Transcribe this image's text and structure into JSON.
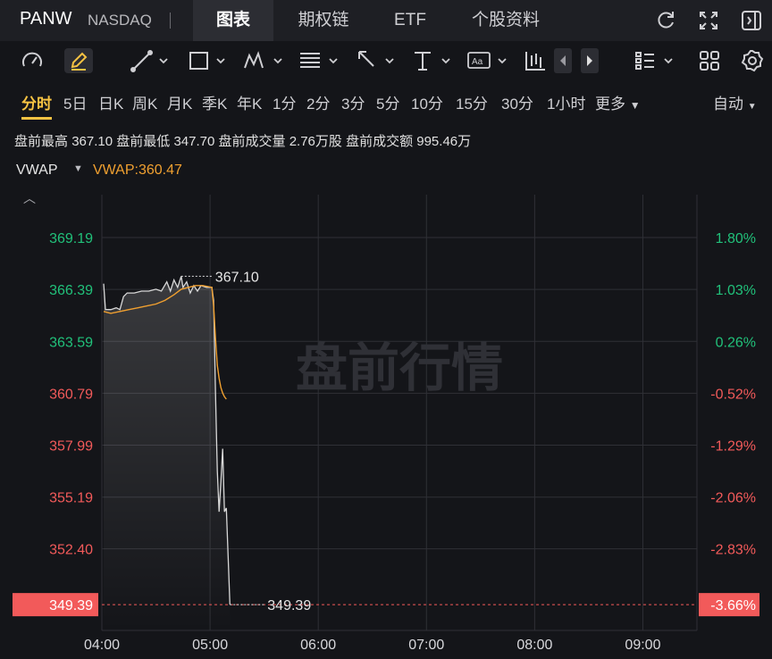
{
  "header": {
    "symbol": "PANW",
    "exchange": "NASDAQ",
    "tabs": [
      {
        "label": "图表",
        "active": true
      },
      {
        "label": "期权链",
        "active": false
      },
      {
        "label": "ETF",
        "active": false
      },
      {
        "label": "个股资料",
        "active": false
      }
    ],
    "icons": [
      "refresh-icon",
      "fullscreen-icon",
      "collapse-panel-icon"
    ]
  },
  "toolbar": {
    "icons": [
      "speedometer-icon",
      "pencil-icon",
      "line-tool-icon",
      "rectangle-tool-icon",
      "pattern-tool-icon",
      "fib-tool-icon",
      "arrow-tool-icon",
      "price-level-icon",
      "text-tool-icon",
      "candlestick-icon",
      "chevron-left-icon",
      "chevron-right-icon",
      "layout-list-icon",
      "grid-icon",
      "settings-icon"
    ]
  },
  "periods": {
    "items": [
      "分时",
      "5日",
      "日K",
      "周K",
      "月K",
      "季K",
      "年K",
      "1分",
      "2分",
      "3分",
      "5分",
      "10分",
      "15分",
      "30分",
      "1小时",
      "更多"
    ],
    "active": "分时",
    "adjust": "自动"
  },
  "info": {
    "premarket_high_label": "盘前最高",
    "premarket_high": "367.10",
    "premarket_low_label": "盘前最低",
    "premarket_low": "347.70",
    "premarket_volume_label": "盘前成交量",
    "premarket_volume": "2.76万股",
    "premarket_turnover_label": "盘前成交额",
    "premarket_turnover": "995.46万"
  },
  "indicator": {
    "name": "VWAP",
    "value_label": "VWAP:360.47"
  },
  "colors": {
    "background": "#141519",
    "grid": "#2f3036",
    "price_line": "#d8d8d8",
    "vwap_line": "#f0a030",
    "up": "#21c17a",
    "down": "#f25a5a",
    "current_badge": "#f25a5a",
    "active_period": "#f6c343"
  },
  "chart_data": {
    "type": "line",
    "watermark": "盘前行情",
    "x_ticks": [
      "04:00",
      "05:00",
      "06:00",
      "07:00",
      "08:00",
      "09:00"
    ],
    "xlim": [
      "04:00",
      "09:30"
    ],
    "y_ticks_left": [
      {
        "value": 369.19,
        "label": "369.19",
        "side": "up"
      },
      {
        "value": 366.39,
        "label": "366.39",
        "side": "up"
      },
      {
        "value": 363.59,
        "label": "363.59",
        "side": "up"
      },
      {
        "value": 360.79,
        "label": "360.79",
        "side": "down"
      },
      {
        "value": 357.99,
        "label": "357.99",
        "side": "down"
      },
      {
        "value": 355.19,
        "label": "355.19",
        "side": "down"
      },
      {
        "value": 352.4,
        "label": "352.40",
        "side": "down"
      }
    ],
    "y_ticks_right": [
      {
        "value": 369.19,
        "label": "1.80%",
        "side": "up"
      },
      {
        "value": 366.39,
        "label": "1.03%",
        "side": "up"
      },
      {
        "value": 363.59,
        "label": "0.26%",
        "side": "up"
      },
      {
        "value": 360.79,
        "label": "-0.52%",
        "side": "down"
      },
      {
        "value": 357.99,
        "label": "-1.29%",
        "side": "down"
      },
      {
        "value": 355.19,
        "label": "-2.06%",
        "side": "down"
      },
      {
        "value": 352.4,
        "label": "-2.83%",
        "side": "down"
      }
    ],
    "ylim": [
      348.0,
      371.5
    ],
    "current_price": {
      "value": 349.39,
      "label": "349.39",
      "pct_label": "-3.66%"
    },
    "high_marker": {
      "time": "04:44",
      "value": 367.1,
      "label": "367.10"
    },
    "low_marker": {
      "time": "05:11",
      "value": 349.39,
      "label": "349.39"
    },
    "series": [
      {
        "name": "price",
        "points": [
          [
            "04:01",
            366.7
          ],
          [
            "04:02",
            365.3
          ],
          [
            "04:05",
            365.3
          ],
          [
            "04:08",
            365.4
          ],
          [
            "04:10",
            365.3
          ],
          [
            "04:12",
            366.0
          ],
          [
            "04:14",
            366.2
          ],
          [
            "04:18",
            366.2
          ],
          [
            "04:22",
            366.3
          ],
          [
            "04:26",
            366.3
          ],
          [
            "04:30",
            366.4
          ],
          [
            "04:33",
            366.3
          ],
          [
            "04:36",
            366.8
          ],
          [
            "04:38",
            366.3
          ],
          [
            "04:40",
            366.9
          ],
          [
            "04:42",
            366.5
          ],
          [
            "04:44",
            367.1
          ],
          [
            "04:45",
            366.5
          ],
          [
            "04:47",
            366.8
          ],
          [
            "04:49",
            366.2
          ],
          [
            "04:51",
            366.6
          ],
          [
            "04:53",
            366.3
          ],
          [
            "04:55",
            366.6
          ],
          [
            "04:58",
            366.5
          ],
          [
            "05:01",
            366.5
          ],
          [
            "05:02",
            365.8
          ],
          [
            "05:03",
            361.0
          ],
          [
            "05:04",
            356.6
          ],
          [
            "05:05",
            354.4
          ],
          [
            "05:06",
            356.0
          ],
          [
            "05:07",
            357.8
          ],
          [
            "05:08",
            354.4
          ],
          [
            "05:09",
            354.6
          ],
          [
            "05:10",
            352.0
          ],
          [
            "05:11",
            349.39
          ]
        ]
      },
      {
        "name": "VWAP",
        "points": [
          [
            "04:01",
            365.2
          ],
          [
            "04:05",
            365.1
          ],
          [
            "04:10",
            365.2
          ],
          [
            "04:15",
            365.3
          ],
          [
            "04:20",
            365.4
          ],
          [
            "04:25",
            365.5
          ],
          [
            "04:30",
            365.6
          ],
          [
            "04:35",
            365.8
          ],
          [
            "04:40",
            366.1
          ],
          [
            "04:44",
            366.4
          ],
          [
            "04:48",
            366.5
          ],
          [
            "04:52",
            366.6
          ],
          [
            "04:56",
            366.6
          ],
          [
            "05:01",
            366.5
          ],
          [
            "05:02",
            365.5
          ],
          [
            "05:03",
            363.8
          ],
          [
            "05:04",
            362.3
          ],
          [
            "05:05",
            361.6
          ],
          [
            "05:06",
            361.1
          ],
          [
            "05:07",
            360.8
          ],
          [
            "05:08",
            360.6
          ],
          [
            "05:09",
            360.47
          ]
        ]
      }
    ]
  }
}
